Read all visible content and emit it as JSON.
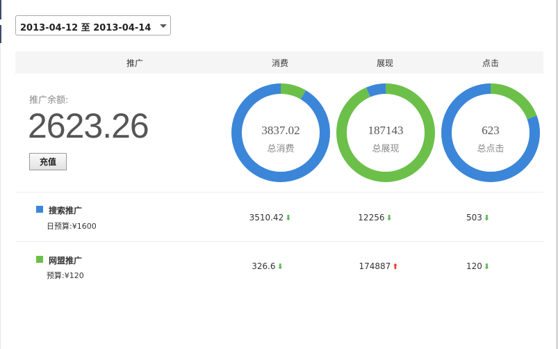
{
  "date_range": {
    "value": "2013-04-12 至 2013-04-14"
  },
  "header": {
    "col_promo": "推广",
    "col_cost": "消费",
    "col_impressions": "展现",
    "col_clicks": "点击"
  },
  "balance": {
    "label": "推广余额:",
    "value": "2623.26",
    "recharge_label": "充值"
  },
  "colors": {
    "search": "#3b86d8",
    "alliance": "#6cc04a"
  },
  "donuts": [
    {
      "value": "3837.02",
      "label": "总消费",
      "search_share": 0.915,
      "alliance_share": 0.085
    },
    {
      "value": "187143",
      "label": "总展现",
      "search_share": 0.065,
      "alliance_share": 0.935
    },
    {
      "value": "623",
      "label": "总点击",
      "search_share": 0.807,
      "alliance_share": 0.193
    }
  ],
  "rows": [
    {
      "name": "搜索推广",
      "budget": "日预算:¥1600",
      "cost": "3510.42",
      "cost_trend": "down",
      "impressions": "12256",
      "impressions_trend": "down",
      "clicks": "503",
      "clicks_trend": "down"
    },
    {
      "name": "网盟推广",
      "budget": "预算:¥120",
      "cost": "326.6",
      "cost_trend": "down",
      "impressions": "174887",
      "impressions_trend": "up",
      "clicks": "120",
      "clicks_trend": "down"
    }
  ],
  "icons": {
    "down": "arrow-down-icon",
    "up": "arrow-up-icon"
  }
}
